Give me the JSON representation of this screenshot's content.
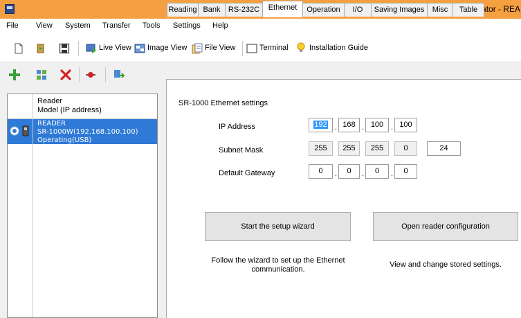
{
  "window": {
    "title": "AutoID Network Navigator - REA"
  },
  "menu": [
    "File",
    "View",
    "System",
    "Transfer",
    "Tools",
    "Settings",
    "Help"
  ],
  "toolbar": {
    "live_view": "Live View",
    "image_view": "Image View",
    "file_view": "File View",
    "terminal": "Terminal",
    "installation_guide": "Installation Guide"
  },
  "reader_list": {
    "header_line1": "Reader",
    "header_line2": "Model (IP address)",
    "rows": [
      {
        "name": "READER",
        "model": "SR-1000W(192.168.100.100)",
        "status": "Operating(USB)"
      }
    ]
  },
  "tabs": [
    "Reading",
    "Bank",
    "RS-232C",
    "Ethernet",
    "Operation",
    "I/O",
    "Saving Images",
    "Misc",
    "Table"
  ],
  "active_tab": "Ethernet",
  "ethernet": {
    "section_title": "SR-1000 Ethernet settings",
    "ip_label": "IP Address",
    "ip": [
      "192",
      "168",
      "100",
      "100"
    ],
    "subnet_label": "Subnet Mask",
    "subnet": [
      "255",
      "255",
      "255",
      "0"
    ],
    "prefix": "24",
    "gateway_label": "Default Gateway",
    "gateway": [
      "0",
      "0",
      "0",
      "0"
    ]
  },
  "actions": {
    "wizard_button": "Start the setup wizard",
    "wizard_desc_line1": "Follow the wizard to set up the Ethernet",
    "wizard_desc_line2": "communication.",
    "config_button": "Open reader configuration",
    "config_desc": "View and change stored settings."
  },
  "colors": {
    "titlebar": "#f5a040",
    "selection": "#2f7ad6",
    "text_selection": "#3399ff"
  }
}
